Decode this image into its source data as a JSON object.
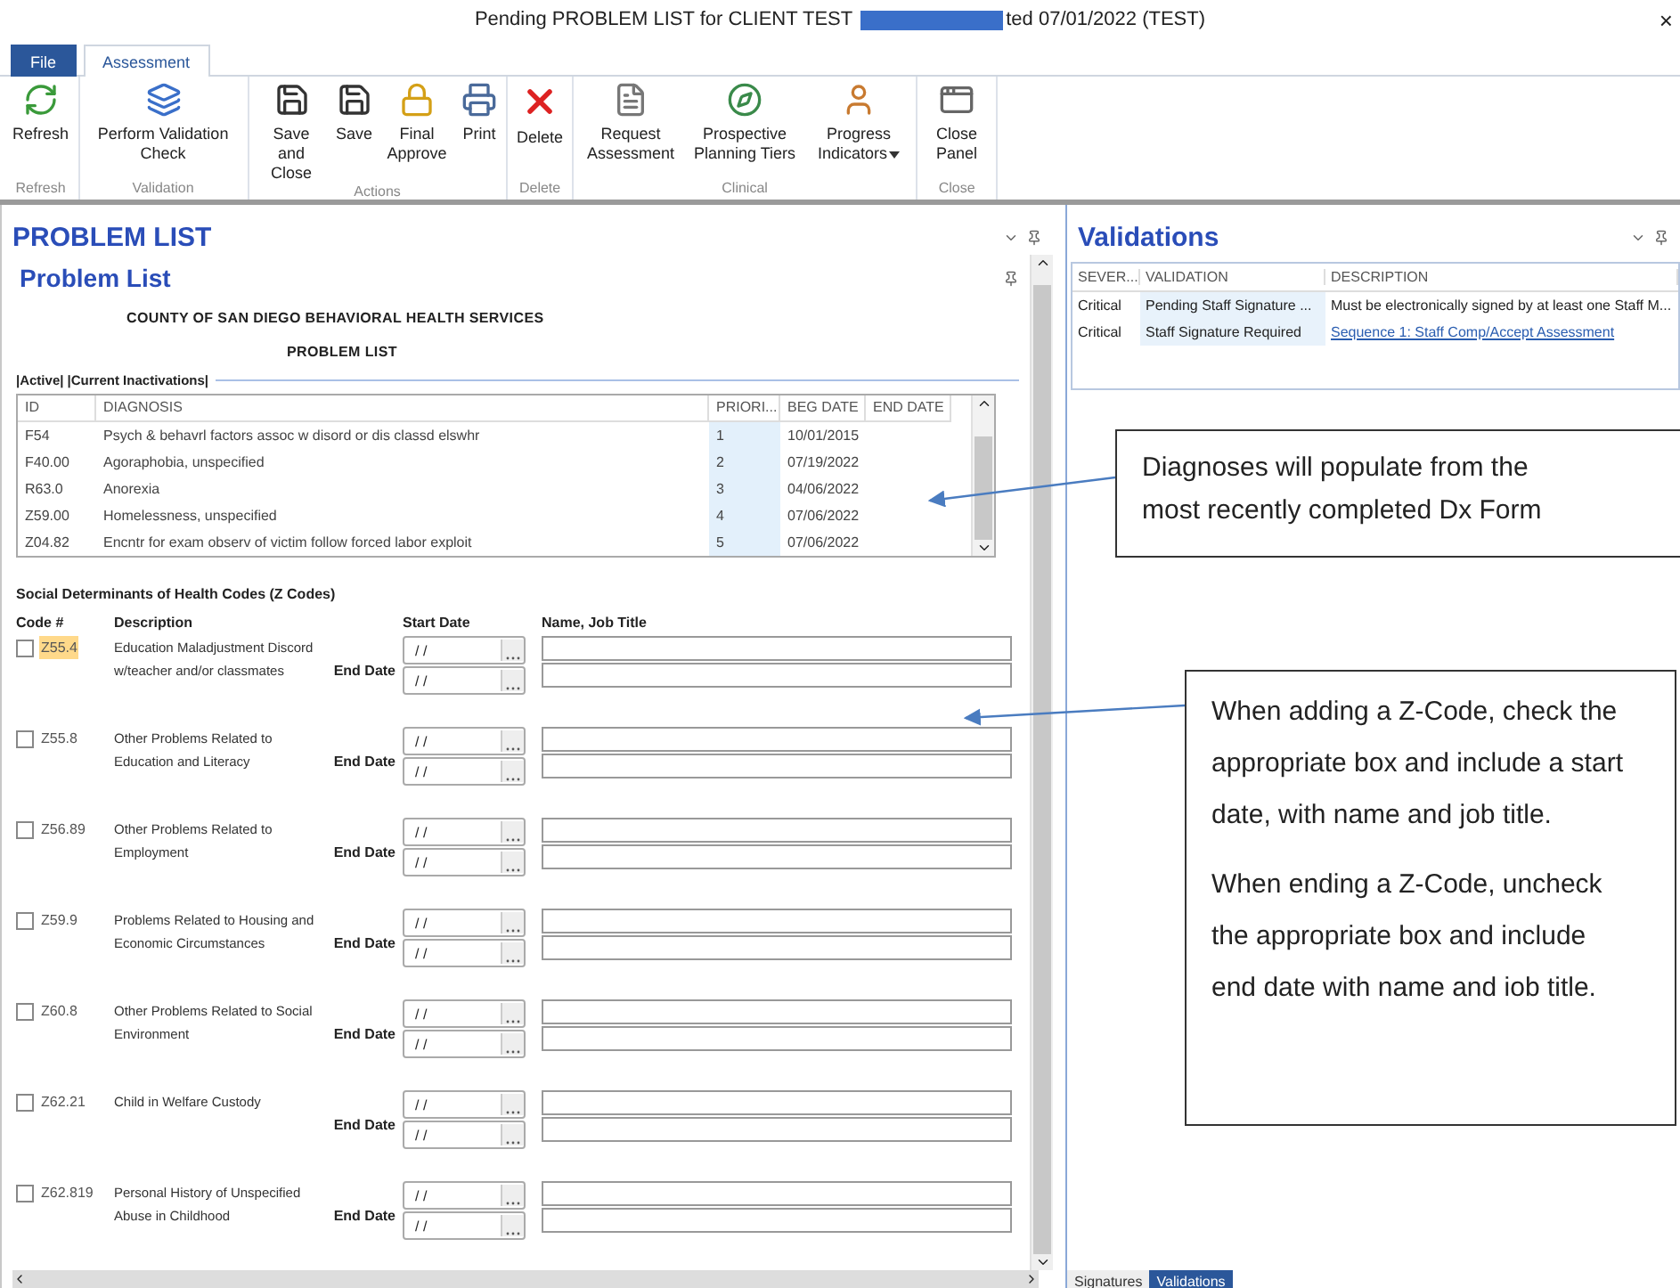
{
  "window": {
    "title_start": "Pending PROBLEM LIST for CLIENT TEST",
    "title_end": "ted 07/01/2022 (TEST)",
    "close": "×"
  },
  "ribbon_tabs": [
    {
      "label": "File",
      "kind": "file",
      "selected": false
    },
    {
      "label": "Assessment",
      "kind": "tab",
      "selected": true
    }
  ],
  "ribbon_groups": [
    {
      "label": "Refresh",
      "buttons": [
        {
          "label": "Refresh",
          "dropdown": false
        }
      ]
    },
    {
      "label": "Validation",
      "buttons": [
        {
          "label": "Perform Validation Check",
          "dropdown": false
        }
      ]
    },
    {
      "label": "Actions",
      "buttons": [
        {
          "label": "Save and Close",
          "dropdown": false
        },
        {
          "label": "Save",
          "dropdown": false
        },
        {
          "label": "Final Approve",
          "dropdown": false
        },
        {
          "label": "Print",
          "dropdown": false
        }
      ]
    },
    {
      "label": "Delete",
      "buttons": [
        {
          "label": "Delete",
          "dropdown": false
        }
      ]
    },
    {
      "label": "Clinical",
      "buttons": [
        {
          "label": "Request Assessment",
          "dropdown": false
        },
        {
          "label": "Prospective Planning Tiers",
          "dropdown": false
        },
        {
          "label": "Progress Indicators",
          "dropdown": true
        }
      ]
    },
    {
      "label": "Close",
      "buttons": [
        {
          "label": "Close Panel",
          "dropdown": false
        }
      ]
    }
  ],
  "problem_panel": {
    "title": "PROBLEM LIST",
    "subtitle": "Problem List",
    "org_heading": "COUNTY OF SAN DIEGO BEHAVIORAL HEALTH SERVICES",
    "form_heading": "PROBLEM LIST",
    "list_tabs": "|Active| |Current Inactivations|",
    "diagnosis_table": {
      "columns": [
        "ID",
        "DIAGNOSIS",
        "PRIORI...",
        "BEG DATE",
        "END DATE"
      ],
      "rows": [
        {
          "id": "F54",
          "diagnosis": "Psych & behavrl factors assoc w disord or dis classd elswhr",
          "priority": "1",
          "beg_date": "10/01/2015"
        },
        {
          "id": "F40.00",
          "diagnosis": "Agoraphobia, unspecified",
          "priority": "2",
          "beg_date": "07/19/2022"
        },
        {
          "id": "R63.0",
          "diagnosis": "Anorexia",
          "priority": "3",
          "beg_date": "04/06/2022"
        },
        {
          "id": "Z59.00",
          "diagnosis": "Homelessness, unspecified",
          "priority": "4",
          "beg_date": "07/06/2022"
        },
        {
          "id": "Z04.82",
          "diagnosis": "Encntr for exam observ of victim follow forced labor exploit",
          "priority": "5",
          "beg_date": "07/06/2022"
        }
      ]
    },
    "zcodes": {
      "title": "Social Determinants of Health Codes (Z Codes)",
      "columns": [
        "Code #",
        "Description",
        "Start Date",
        "Name, Job Title"
      ],
      "rows": [
        {
          "code": "Z55.4",
          "description": "Education Maladjustment Discord w/teacher and/or classmates",
          "checked": false,
          "focused": true,
          "start_date": "/ /",
          "end_label": "End Date",
          "end_date": "/ /"
        },
        {
          "code": "Z55.8",
          "description": "Other Problems Related to Education and Literacy",
          "checked": false,
          "focused": false,
          "start_date": "/ /",
          "end_label": "End Date",
          "end_date": "/ /"
        },
        {
          "code": "Z56.89",
          "description": "Other Problems Related to Employment",
          "checked": false,
          "focused": false,
          "start_date": "/ /",
          "end_label": "End Date",
          "end_date": "/ /"
        },
        {
          "code": "Z59.9",
          "description": "Problems Related to Housing and Economic Circumstances",
          "checked": false,
          "focused": false,
          "start_date": "/ /",
          "end_label": "End Date",
          "end_date": "/ /"
        },
        {
          "code": "Z60.8",
          "description": "Other Problems Related to Social Environment",
          "checked": false,
          "focused": false,
          "start_date": "/ /",
          "end_label": "End Date",
          "end_date": "/ /"
        },
        {
          "code": "Z62.21",
          "description": "Child in Welfare Custody",
          "checked": false,
          "focused": false,
          "start_date": "/ /",
          "end_label": "End Date",
          "end_date": "/ /"
        },
        {
          "code": "Z62.819",
          "description": "Personal History of Unspecified Abuse in Childhood",
          "checked": false,
          "focused": false,
          "start_date": "/ /",
          "end_label": "End Date",
          "end_date": "/ /"
        }
      ]
    }
  },
  "validations_panel": {
    "title": "Validations",
    "columns": [
      "SEVER...",
      "VALIDATION",
      "DESCRIPTION"
    ],
    "rows": [
      {
        "severity": "Critical",
        "validation": "Pending Staff Signature ...",
        "description": "Must be electronically signed by at least one Staff M...",
        "kind": "text"
      },
      {
        "severity": "Critical",
        "validation": "Staff Signature Required",
        "description": "Sequence 1: Staff Comp/Accept Assessment",
        "kind": "link"
      }
    ],
    "bottom_tabs": [
      {
        "label": "Signatures",
        "selected": false
      },
      {
        "label": "Validations",
        "selected": true
      }
    ]
  },
  "callouts": [
    {
      "paragraphs": [
        "Diagnoses will populate from the most recently completed Dx Form"
      ]
    },
    {
      "paragraphs": [
        "When adding a Z-Code, check the appropriate box and include a start date, with name and job title.",
        "When ending a Z-Code, uncheck the appropriate box and include end date with name and iob title."
      ]
    }
  ]
}
